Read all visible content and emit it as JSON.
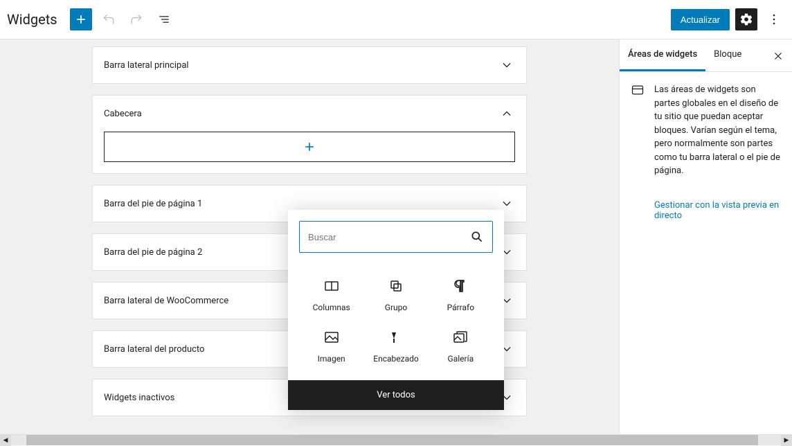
{
  "header": {
    "title": "Widgets",
    "update_label": "Actualizar"
  },
  "areas": [
    {
      "title": "Barra lateral principal",
      "open": false
    },
    {
      "title": "Cabecera",
      "open": true
    },
    {
      "title": "Barra del pie de página 1",
      "open": false
    },
    {
      "title": "Barra del pie de página 2",
      "open": false
    },
    {
      "title": "Barra lateral de WooCommerce",
      "open": false
    },
    {
      "title": "Barra lateral del producto",
      "open": false
    },
    {
      "title": "Widgets inactivos",
      "open": false
    }
  ],
  "inserter": {
    "search_placeholder": "Buscar",
    "blocks": [
      {
        "name": "columns",
        "label": "Columnas"
      },
      {
        "name": "group",
        "label": "Grupo"
      },
      {
        "name": "paragraph",
        "label": "Párrafo"
      },
      {
        "name": "image",
        "label": "Imagen"
      },
      {
        "name": "heading",
        "label": "Encabezado"
      },
      {
        "name": "gallery",
        "label": "Galería"
      }
    ],
    "view_all": "Ver todos"
  },
  "sidebar": {
    "tabs": {
      "areas": "Áreas de widgets",
      "block": "Bloque"
    },
    "description": "Las áreas de widgets son partes globales en el diseño de tu sitio que puedan aceptar bloques. Varían según el tema, pero normalmente son partes como tu barra lateral o el pie de página.",
    "manage_link": "Gestionar con la vista previa en directo"
  }
}
